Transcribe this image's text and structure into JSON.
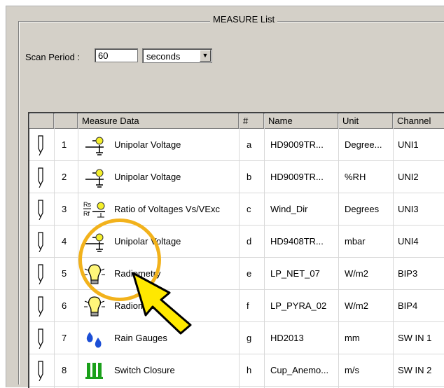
{
  "group_title": "MEASURE List",
  "scan": {
    "label": "Scan Period :",
    "value": "60",
    "unit": "seconds"
  },
  "columns": [
    "",
    "Measure Data",
    "#",
    "Name",
    "Unit",
    "Channel"
  ],
  "rows": [
    {
      "index": "1",
      "type": "Unipolar Voltage",
      "icon": "unipolar-voltage-icon",
      "letter": "a",
      "name": "HD9009TR...",
      "unit": "Degree...",
      "channel": "UNI1"
    },
    {
      "index": "2",
      "type": "Unipolar Voltage",
      "icon": "unipolar-voltage-icon",
      "letter": "b",
      "name": "HD9009TR...",
      "unit": "%RH",
      "channel": "UNI2"
    },
    {
      "index": "3",
      "type": "Ratio of Voltages Vs/VExc",
      "icon": "ratio-voltages-icon",
      "letter": "c",
      "name": "Wind_Dir",
      "unit": "Degrees",
      "channel": "UNI3"
    },
    {
      "index": "4",
      "type": "Unipolar Voltage",
      "icon": "unipolar-voltage-icon",
      "letter": "d",
      "name": "HD9408TR...",
      "unit": "mbar",
      "channel": "UNI4"
    },
    {
      "index": "5",
      "type": "Radiometry",
      "icon": "radiometry-bulb-icon",
      "letter": "e",
      "name": "LP_NET_07",
      "unit": "W/m2",
      "channel": "BIP3"
    },
    {
      "index": "6",
      "type": "Radiometry",
      "icon": "radiometry-bulb-icon",
      "letter": "f",
      "name": "LP_PYRA_02",
      "unit": "W/m2",
      "channel": "BIP4"
    },
    {
      "index": "7",
      "type": "Rain Gauges",
      "icon": "rain-drops-icon",
      "letter": "g",
      "name": "HD2013",
      "unit": "mm",
      "channel": "SW IN 1"
    },
    {
      "index": "8",
      "type": "Switch Closure",
      "icon": "switch-closure-icon",
      "letter": "h",
      "name": "Cup_Anemo...",
      "unit": "m/s",
      "channel": "SW IN 2"
    }
  ],
  "colors": {
    "highlight_ring": "#f2b21c",
    "arrow_fill": "#ffe800",
    "rain_blue": "#1c4fd6",
    "switch_green": "#1aa01a"
  }
}
